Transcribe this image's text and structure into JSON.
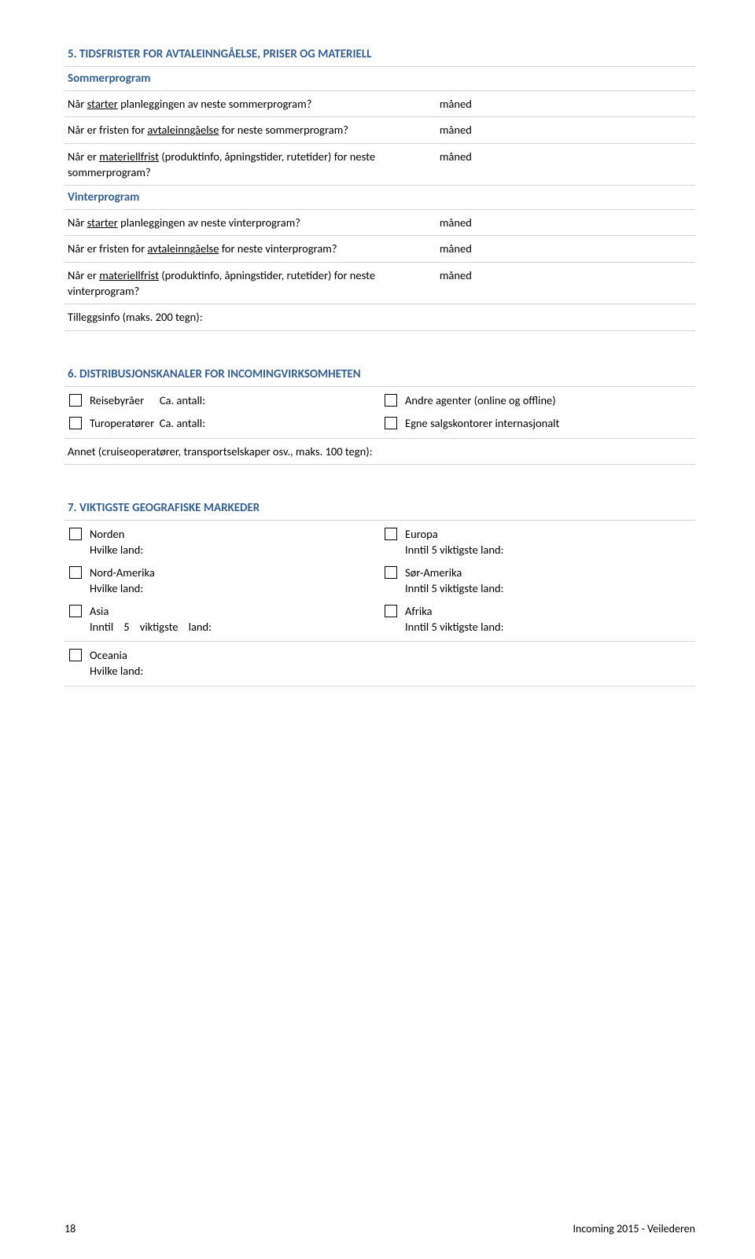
{
  "section5": {
    "title": "5.   TIDSFRISTER FOR AVTALEINNGÅELSE, PRISER OG MATERIELL",
    "sommer_heading": "Sommerprogram",
    "q_s1_a": "Når ",
    "q_s1_u": "starter",
    "q_s1_b": " planleggingen av neste sommerprogram?",
    "q_s2_a": "Når er fristen for ",
    "q_s2_u": "avtaleinngåelse",
    "q_s2_b": " for neste sommerprogram?",
    "q_s3_a": "Når er ",
    "q_s3_u": "materiellfrist",
    "q_s3_b": " (produktinfo, åpningstider, rutetider) for neste sommerprogram?",
    "vinter_heading": "Vinterprogram",
    "q_v1_a": "Når ",
    "q_v1_u": "starter",
    "q_v1_b": " planleggingen av neste vinterprogram?",
    "q_v2_a": "Når er fristen for ",
    "q_v2_u": "avtaleinngåelse",
    "q_v2_b": " for neste vinterprogram?",
    "q_v3_a": "Når er ",
    "q_v3_u": "materiellfrist",
    "q_v3_b": " (produktinfo, åpningstider, rutetider) for neste vinterprogram?",
    "unit": "måned",
    "extra": "Tilleggsinfo (maks. 200 tegn):"
  },
  "section6": {
    "title": "6.   DISTRIBUSJONSKANALER FOR INCOMINGVIRKSOMHETEN",
    "opt1_a": "Reisebyråer",
    "opt1_b": "Ca. antall:",
    "opt2_a": "Turoperatører",
    "opt2_b": "Ca. antall:",
    "opt3": "Andre agenter (online og offline)",
    "opt4": "Egne salgskontorer internasjonalt",
    "other": "Annet (cruiseoperatører, transportselskaper osv., maks. 100 tegn):"
  },
  "section7": {
    "title": "7.   VIKTIGSTE GEOGRAFISKE MARKEDER",
    "norden": "Norden",
    "norden_sub": "Hvilke land:",
    "nordam": "Nord-Amerika",
    "nordam_sub": "Hvilke land:",
    "asia": "Asia",
    "asia_sub_a": "Inntil",
    "asia_sub_num": "5",
    "asia_sub_b": "viktigste",
    "asia_sub_c": "land:",
    "europa": "Europa",
    "europa_sub": "Inntil 5 viktigste land:",
    "soram": "Sør-Amerika",
    "soram_sub": "Inntil 5 viktigste land:",
    "afrika": "Afrika",
    "afrika_sub": "Inntil 5 viktigste land:",
    "oceania": "Oceania",
    "oceania_sub": "Hvilke land:"
  },
  "footer": {
    "page": "18",
    "doc": "Incoming 2015 - Veilederen"
  }
}
